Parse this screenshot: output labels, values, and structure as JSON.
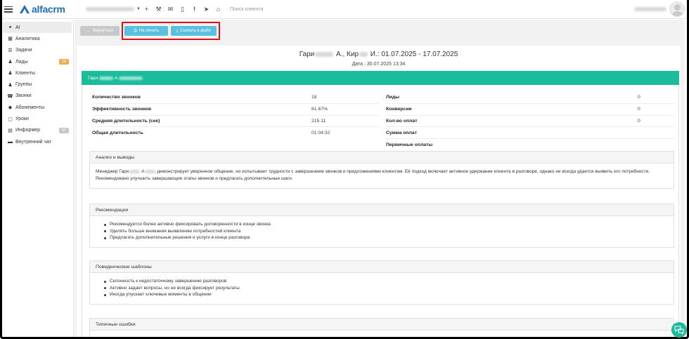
{
  "header": {
    "logo_text": "alfacrm",
    "search_placeholder": "Поиск клиента",
    "tools": [
      {
        "name": "add-icon",
        "glyph": "+"
      },
      {
        "name": "wrench-icon",
        "glyph": "⚒"
      },
      {
        "name": "mail-icon",
        "glyph": "✉"
      },
      {
        "name": "phone-icon",
        "glyph": "▯"
      },
      {
        "name": "facebook-icon",
        "glyph": "f"
      },
      {
        "name": "telegram-icon",
        "glyph": "➤"
      },
      {
        "name": "bell-icon",
        "glyph": "⌂"
      }
    ]
  },
  "sidebar": {
    "items": [
      {
        "label": "AI",
        "icon": "sparkle-icon",
        "glyph": "✦",
        "active": true
      },
      {
        "label": "Аналитика",
        "icon": "grid-icon",
        "glyph": "▦"
      },
      {
        "label": "Задачи",
        "icon": "list-icon",
        "glyph": "☰"
      },
      {
        "label": "Лиды",
        "icon": "user-plus-icon",
        "glyph": "♟",
        "badge": "18",
        "badge_color": "#f0ad4e"
      },
      {
        "label": "Клиенты",
        "icon": "user-icon",
        "glyph": "♟"
      },
      {
        "label": "Группы",
        "icon": "users-icon",
        "glyph": "♟"
      },
      {
        "label": "Звонки",
        "icon": "phone-icon",
        "glyph": "☎"
      },
      {
        "label": "Абонементы",
        "icon": "tag-icon",
        "glyph": "◆"
      },
      {
        "label": "Уроки",
        "icon": "calendar-icon",
        "glyph": "▢"
      },
      {
        "label": "Информер",
        "icon": "inbox-icon",
        "glyph": "▤",
        "badge": "67",
        "badge_color": "#c8c8c8"
      },
      {
        "label": "Внутренний чат",
        "icon": "chat-icon",
        "glyph": "▬"
      }
    ]
  },
  "actions": {
    "back": "Вернуться",
    "print": "На печать",
    "download": "Скачать в файл"
  },
  "report": {
    "title_start": "Гари",
    "title_mid1": "А., Кир",
    "title_end": "И.: 01.07.2025 - 17.07.2025",
    "date": "Дата : 30.07.2025 13:34",
    "manager_first": "Гари",
    "manager_second": "А"
  },
  "metrics_left": [
    {
      "label": "Количество звонков",
      "value": "18"
    },
    {
      "label": "Эффективность звонков",
      "value": "61.67%"
    },
    {
      "label": "Средняя длительность (сек)",
      "value": "215.11"
    },
    {
      "label": "Общая длительность",
      "value": "01:04:32"
    }
  ],
  "metrics_right": [
    {
      "label": "Лиды",
      "value": "0"
    },
    {
      "label": "Конверсии",
      "value": "0"
    },
    {
      "label": "Кол-во оплат",
      "value": "0"
    },
    {
      "label": "Сумма оплат",
      "value": ""
    },
    {
      "label": "Первичные оплаты",
      "value": ""
    }
  ],
  "sections": {
    "analysis": {
      "title": "Анализ и выводы",
      "text_prefix": "Менеджер Гари",
      "text_mid": "А",
      "text_rest": "демонстрирует уверенное общение, но испытывает трудности с завершением звонков и предложениями клиентам. Её подход включает активное удержание клиента в разговоре, однако не всегда удается выявить его потребности. Рекомендовано улучшить завершающие этапы звонков и предлагать дополнительные шаги."
    },
    "recommendations": {
      "title": "Рекомендации",
      "items": [
        "Рекомендуется более активно фиксировать договоренности в конце звонка",
        "Уделять больше внимания выявлению потребностей клиента",
        "Предлагать дополнительные решения и услуги в конце разговора"
      ]
    },
    "patterns": {
      "title": "Поведенческие шаблоны",
      "items": [
        "Склонность к недостаточному завершению разговоров",
        "Активно задает вопросы, но не всегда фиксирует результаты",
        "Иногда упускает ключевые моменты в общении"
      ]
    },
    "mistakes": {
      "title": "Типичные ошибки"
    }
  },
  "colors": {
    "accent": "#1abc9c",
    "button": "#5bc0de",
    "highlight": "#e01010",
    "brand": "#1f6fb5"
  }
}
